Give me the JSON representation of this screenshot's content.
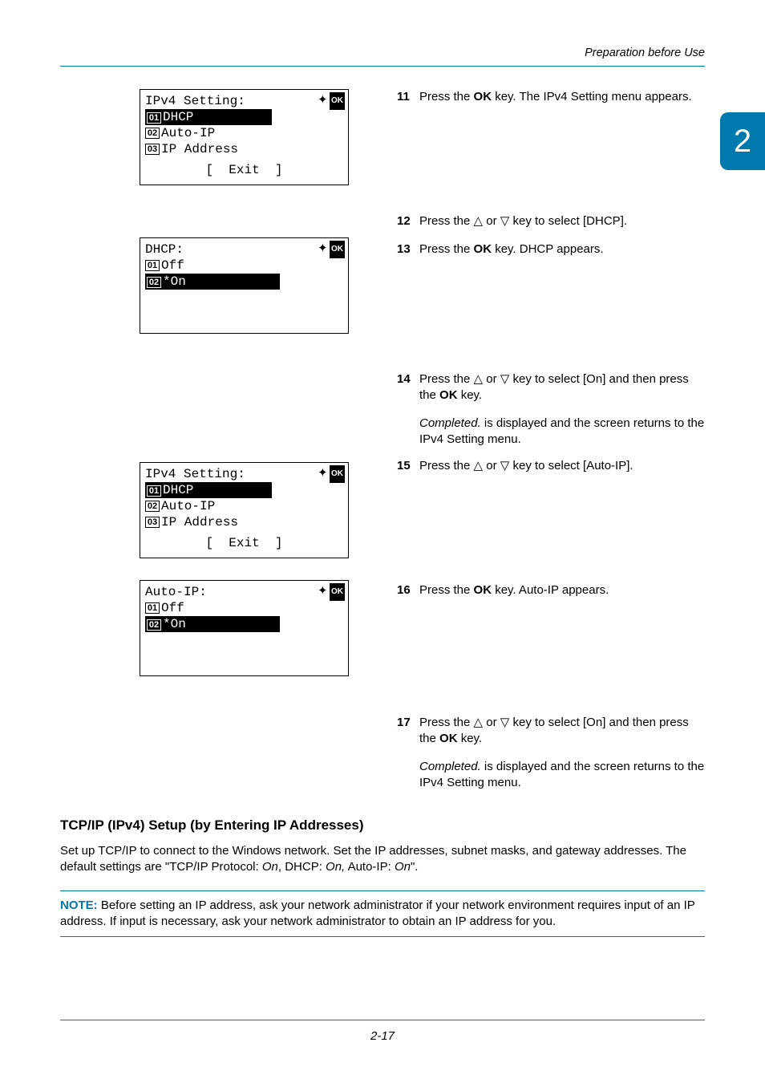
{
  "header": {
    "section": "Preparation before Use"
  },
  "chapter": "2",
  "lcd1": {
    "title": "IPv4 Setting:",
    "row1_num": "01",
    "row1": "DHCP",
    "row2_num": "02",
    "row2": "Auto-IP",
    "row3_num": "03",
    "row3": "IP Address",
    "exit": "[  Exit  ]"
  },
  "lcd2": {
    "title": "DHCP:",
    "row1_num": "01",
    "row1": "Off",
    "row2_num": "02",
    "row2": "*On"
  },
  "lcd3": {
    "title": "IPv4 Setting:",
    "row1_num": "01",
    "row1": "DHCP",
    "row2_num": "02",
    "row2": "Auto-IP",
    "row3_num": "03",
    "row3": "IP Address",
    "exit": "[  Exit  ]"
  },
  "lcd4": {
    "title": "Auto-IP:",
    "row1_num": "01",
    "row1": "Off",
    "row2_num": "02",
    "row2": "*On"
  },
  "steps": {
    "s11": {
      "n": "11",
      "t1": "Press the ",
      "ok": "OK",
      "t2": " key. The IPv4 Setting menu appears."
    },
    "s12": {
      "n": "12",
      "t1": "Press the ",
      "t2": " or ",
      "t3": " key to select [DHCP]."
    },
    "s13": {
      "n": "13",
      "t1": "Press the ",
      "ok": "OK",
      "t2": " key. DHCP appears."
    },
    "s14": {
      "n": "14",
      "t1": "Press the ",
      "t2": " or ",
      "t3": " key to select [On] and then press the ",
      "ok": "OK",
      "t4": " key.",
      "completed": "Completed.",
      "p2": " is displayed and the screen returns to the IPv4 Setting menu."
    },
    "s15": {
      "n": "15",
      "t1": "Press the ",
      "t2": " or ",
      "t3": " key to select [Auto-IP]."
    },
    "s16": {
      "n": "16",
      "t1": "Press the ",
      "ok": "OK",
      "t2": " key. Auto-IP appears."
    },
    "s17": {
      "n": "17",
      "t1": "Press the ",
      "t2": " or ",
      "t3": " key to select [On] and then press the ",
      "ok": "OK",
      "t4": " key.",
      "completed": "Completed.",
      "p2": " is displayed and the screen returns to the IPv4 Setting menu."
    }
  },
  "section_heading": "TCP/IP (IPv4) Setup (by Entering IP Addresses)",
  "section_body_a": "Set up TCP/IP to connect to the Windows network. Set the IP addresses, subnet masks, and gateway addresses. The default settings are \"TCP/IP Protocol: ",
  "section_body_b": "On",
  "section_body_c": ", DHCP: ",
  "section_body_d": "On,",
  "section_body_e": " Auto-IP: ",
  "section_body_f": "On",
  "section_body_g": "\".",
  "note_label": "NOTE:",
  "note_text": " Before setting an IP address, ask your network administrator if your network environment requires input of an IP address. If input is necessary, ask your network administrator to obtain an IP address for you.",
  "page_number": "2-17",
  "icons": {
    "nav": "✧",
    "ok": "OK"
  }
}
